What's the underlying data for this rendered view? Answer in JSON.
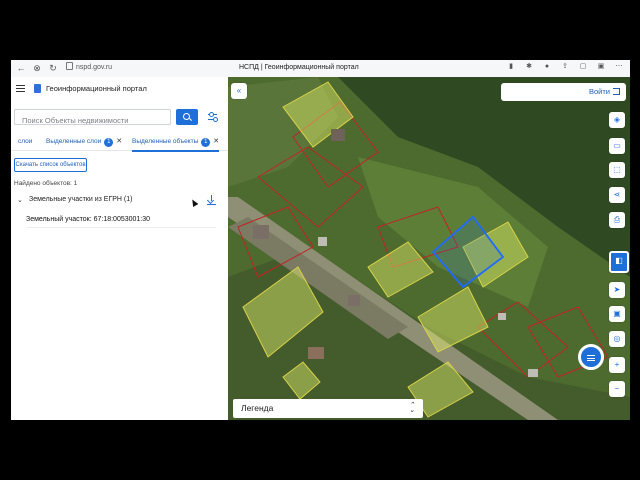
{
  "browser": {
    "url": "nspd.gov.ru",
    "page_title": "НСПД | Геоинформационный портал"
  },
  "header": {
    "app_title": "Геоинформационный портал"
  },
  "search": {
    "placeholder": "Поиск Объекты недвижимости"
  },
  "tabs": [
    {
      "label": "слои",
      "count": null
    },
    {
      "label": "Выделенные слои",
      "count": "1"
    },
    {
      "label": "Выделенные объекты",
      "count": "1"
    }
  ],
  "download_label": "Скачать список объектов",
  "found_label": "Найдено объектов: 1",
  "group": {
    "label": "Земельные участки из ЕГРН (1)"
  },
  "parcel": {
    "label": "Земельный участок: 67:18:0053001:30"
  },
  "map": {
    "login_label": "Войти",
    "legend_label": "Легенда",
    "collapse_icon": "«"
  },
  "colors": {
    "accent": "#1f6fd8",
    "parcel_outline": "#c02525",
    "parcel_fill": "#e3f06a",
    "selected_parcel": "#1e6bff"
  }
}
